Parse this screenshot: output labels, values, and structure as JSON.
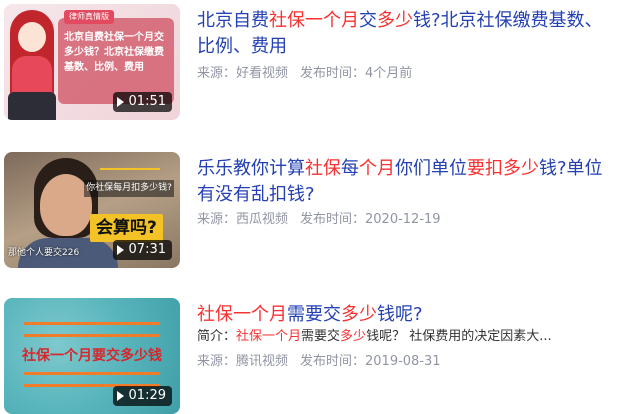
{
  "results": [
    {
      "thumbnail": {
        "tag": "律师真情版",
        "overlay_text": "北京自费社保一个月交多少钱？北京社保缴费基数、比例、费用",
        "duration": "01:51"
      },
      "title_parts": [
        "北京自费",
        "社保一个月",
        "交",
        "多少",
        "钱?北京社保缴费基数、比例、费用"
      ],
      "meta": {
        "source": "来源：好看视频",
        "time": "发布时间：4个月前"
      }
    },
    {
      "thumbnail": {
        "caption": "你社保每月扣多少钱?",
        "big_text": "会算吗?",
        "bottom_caption": "那他个人要交226",
        "duration": "07:31"
      },
      "title_parts": [
        "乐乐教你计算",
        "社保",
        "每",
        "个月",
        "你们单位",
        "要扣多少",
        "钱?单位有没有乱扣钱?"
      ],
      "meta": {
        "source": "来源：西瓜视频",
        "time": "发布时间：2020-12-19"
      }
    },
    {
      "thumbnail": {
        "overlay_text": "社保一个月要交多少钱",
        "duration": "01:29"
      },
      "title_parts": [
        "社保一个月",
        "需要交",
        "多少",
        "钱呢?"
      ],
      "snippet_parts": [
        "简介：",
        "社保一个月",
        "需要交",
        "多少",
        "钱呢？ 社保费用的决定因素大..."
      ],
      "meta": {
        "source": "来源：腾讯视频",
        "time": "发布时间：2019-08-31"
      }
    }
  ],
  "colors": {
    "title": "#2440b3",
    "highlight": "#f73131",
    "meta": "#9195a3"
  }
}
